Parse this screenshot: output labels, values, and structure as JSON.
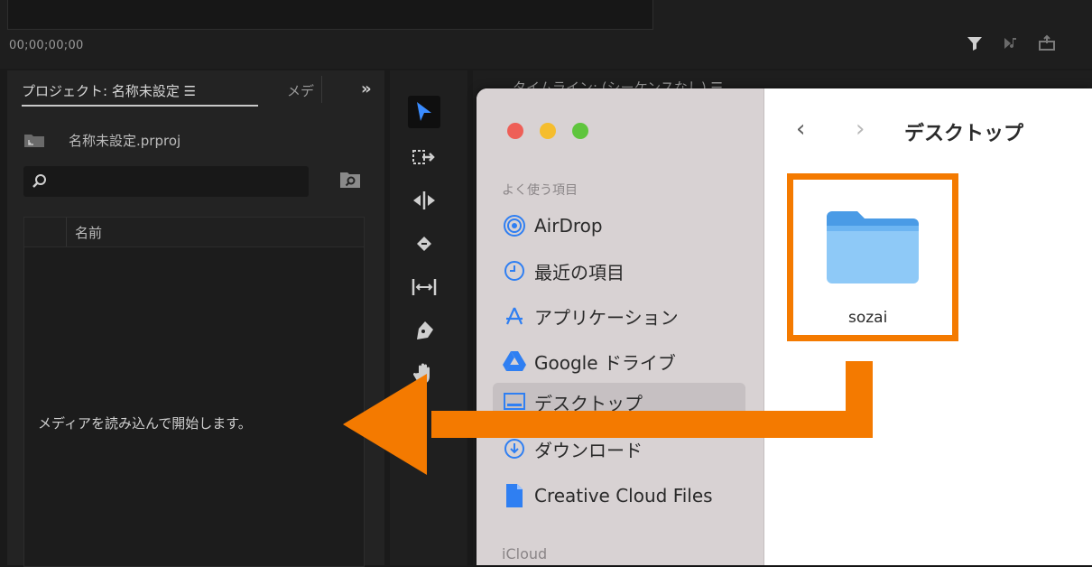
{
  "top": {
    "timecode": "00;00;00;00",
    "icons": [
      "filter-icon",
      "play-marker-icon",
      "export-frame-icon"
    ]
  },
  "project_panel": {
    "tab_label": "プロジェクト: 名称未設定 ☰",
    "media_tab_label": "メデ",
    "expand_icon": "»",
    "file_name": "名称未設定.prproj",
    "search_placeholder": "",
    "column_name": "名前",
    "empty_message": "メディアを読み込んで開始します。"
  },
  "timeline": {
    "title": "タイムライン: (シーケンスなし) ☰"
  },
  "tools": [
    "selection-tool",
    "track-select-tool",
    "ripple-edit-tool",
    "razor-tool",
    "slip-tool",
    "pen-tool",
    "hand-tool"
  ],
  "finder": {
    "favorites_heading": "よく使う項目",
    "sidebar_items": [
      {
        "label": "AirDrop",
        "icon": "airdrop-icon"
      },
      {
        "label": "最近の項目",
        "icon": "clock-icon"
      },
      {
        "label": "アプリケーション",
        "icon": "applications-icon"
      },
      {
        "label": "Google ドライブ",
        "icon": "google-drive-icon"
      },
      {
        "label": "デスクトップ",
        "icon": "desktop-icon"
      },
      {
        "label": "ダウンロード",
        "icon": "download-icon"
      },
      {
        "label": "Creative Cloud Files",
        "icon": "document-icon"
      }
    ],
    "icloud_heading": "iCloud",
    "back_symbol": "‹",
    "forward_symbol": "›",
    "window_title": "デスクトップ",
    "folder_name": "sozai"
  },
  "colors": {
    "highlight": "#f47a00",
    "accent_blue": "#2f7ff2",
    "panel_bg": "#232323"
  }
}
